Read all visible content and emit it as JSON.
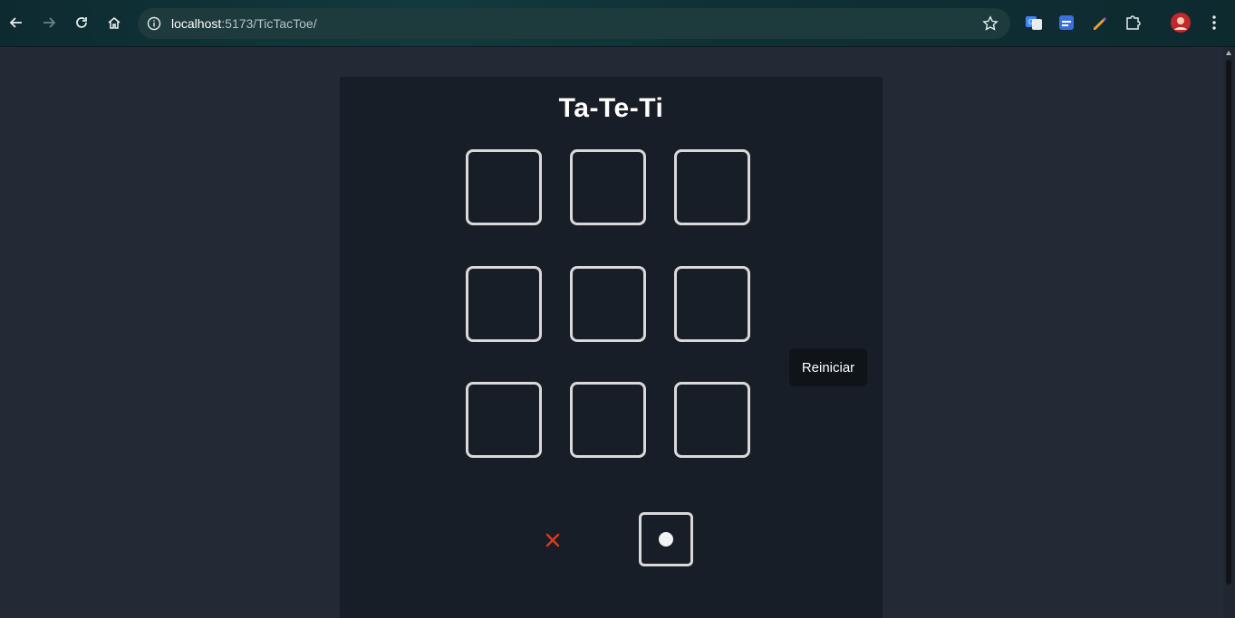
{
  "browser": {
    "url_host": "localhost",
    "url_rest": ":5173/TicTacToe/",
    "icons": [
      "back-icon",
      "forward-icon",
      "reload-icon",
      "home-icon",
      "info-icon",
      "star-icon",
      "translate-icon",
      "extension-icon",
      "pencil-icon",
      "puzzle-icon",
      "avatar",
      "menu-icon"
    ]
  },
  "game": {
    "title": "Ta-Te-Ti",
    "board": [
      "",
      "",
      "",
      "",
      "",
      "",
      "",
      "",
      ""
    ],
    "restart_label": "Reiniciar",
    "turn_indicators": {
      "x_symbol": "×",
      "o_active": true
    },
    "colors": {
      "x": "#e0391f",
      "cell_border": "#d9d9d9",
      "panel": "#181e27",
      "page": "#222a35"
    }
  }
}
